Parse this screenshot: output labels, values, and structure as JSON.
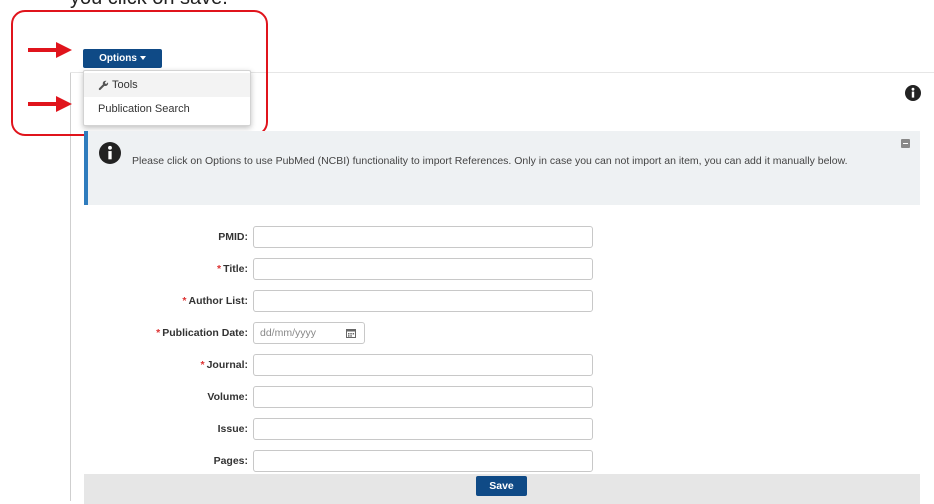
{
  "caption": "you click on save.",
  "toolbar": {
    "options_label": "Options"
  },
  "options_menu": {
    "items": [
      {
        "label": "Tools",
        "icon": "wrench-icon"
      },
      {
        "label": "Publication Search"
      }
    ]
  },
  "notice": {
    "text": "Please click on Options to use PubMed (NCBI) functionality to import References. Only in case you can not import an item, you can add it manually below."
  },
  "form": {
    "fields": [
      {
        "label": "PMID:",
        "required": false,
        "value": ""
      },
      {
        "label": "Title:",
        "required": true,
        "value": ""
      },
      {
        "label": "Author List:",
        "required": true,
        "value": ""
      },
      {
        "label": "Publication Date:",
        "required": true,
        "value": "",
        "placeholder": "dd/mm/yyyy"
      },
      {
        "label": "Journal:",
        "required": true,
        "value": ""
      },
      {
        "label": "Volume:",
        "required": false,
        "value": ""
      },
      {
        "label": "Issue:",
        "required": false,
        "value": ""
      },
      {
        "label": "Pages:",
        "required": false,
        "value": ""
      }
    ],
    "required_marker": "*",
    "save_label": "Save"
  },
  "colors": {
    "primary": "#0f4a86",
    "annotation_red": "#e0141c",
    "notice_border": "#2f7cbd",
    "notice_bg": "#eef1f3"
  }
}
